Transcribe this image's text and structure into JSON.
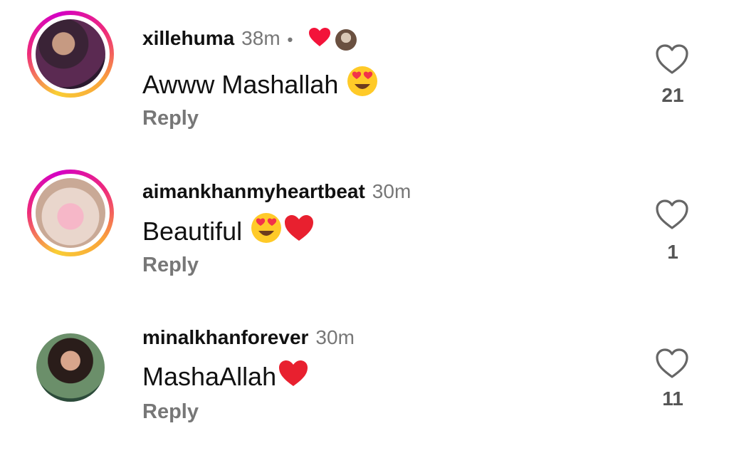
{
  "comments": [
    {
      "username": "xillehuma",
      "time": "38m",
      "separator": "•",
      "text": "Awww Mashallah",
      "emojis": [
        "heart-eyes-emoji"
      ],
      "reply_label": "Reply",
      "like_count": "21",
      "liked_by_creator": true
    },
    {
      "username": "aimankhanmyheartbeat",
      "time": "30m",
      "text": "Beautiful",
      "emojis": [
        "heart-eyes-emoji",
        "red-heart-emoji"
      ],
      "reply_label": "Reply",
      "like_count": "1"
    },
    {
      "username": "minalkhanforever",
      "time": "30m",
      "text": "MashaAllah",
      "emojis": [
        "red-heart-emoji"
      ],
      "reply_label": "Reply",
      "like_count": "11"
    }
  ],
  "colors": {
    "heart_red": "#f3133a",
    "muted_text": "#777777",
    "story_ring_start": "#f9ce34",
    "story_ring_mid": "#ee2a7b"
  }
}
